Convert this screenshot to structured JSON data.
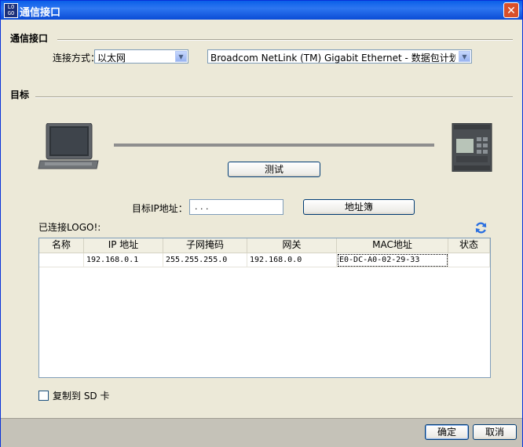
{
  "window": {
    "title": "通信接口",
    "app_icon_text": "LOGO\nSoft"
  },
  "interface_section": {
    "title": "通信接口",
    "connection_label": "连接方式：",
    "connection_value": "以太网",
    "adapter_value": "Broadcom NetLink (TM) Gigabit Ethernet - 数据包计划程..."
  },
  "target_section": {
    "title": "目标",
    "test_button": "测试",
    "ip_label": "目标IP地址：",
    "ip_value": " .  .  .",
    "address_book_button": "地址簿",
    "connected_label": "已连接LOGO!:"
  },
  "table": {
    "columns": [
      "名称",
      "IP 地址",
      "子网掩码",
      "网关",
      "MAC地址",
      "状态"
    ],
    "rows": [
      {
        "name": "",
        "ip": "192.168.0.1",
        "subnet": "255.255.255.0",
        "gateway": "192.168.0.0",
        "mac": "E0-DC-A0-02-29-33",
        "status": ""
      }
    ]
  },
  "copy_sd": {
    "label": "复制到 SD 卡",
    "checked": false
  },
  "footer": {
    "ok": "确定",
    "cancel": "取消"
  },
  "colors": {
    "titlebar": "#0A5FE8",
    "dialog_bg": "#ECE9D8",
    "refresh": "#2A6FE0"
  },
  "icons": [
    "close-icon",
    "dropdown-arrow-icon",
    "laptop-icon",
    "logo-plc-icon",
    "refresh-icon",
    "checkbox-icon"
  ]
}
